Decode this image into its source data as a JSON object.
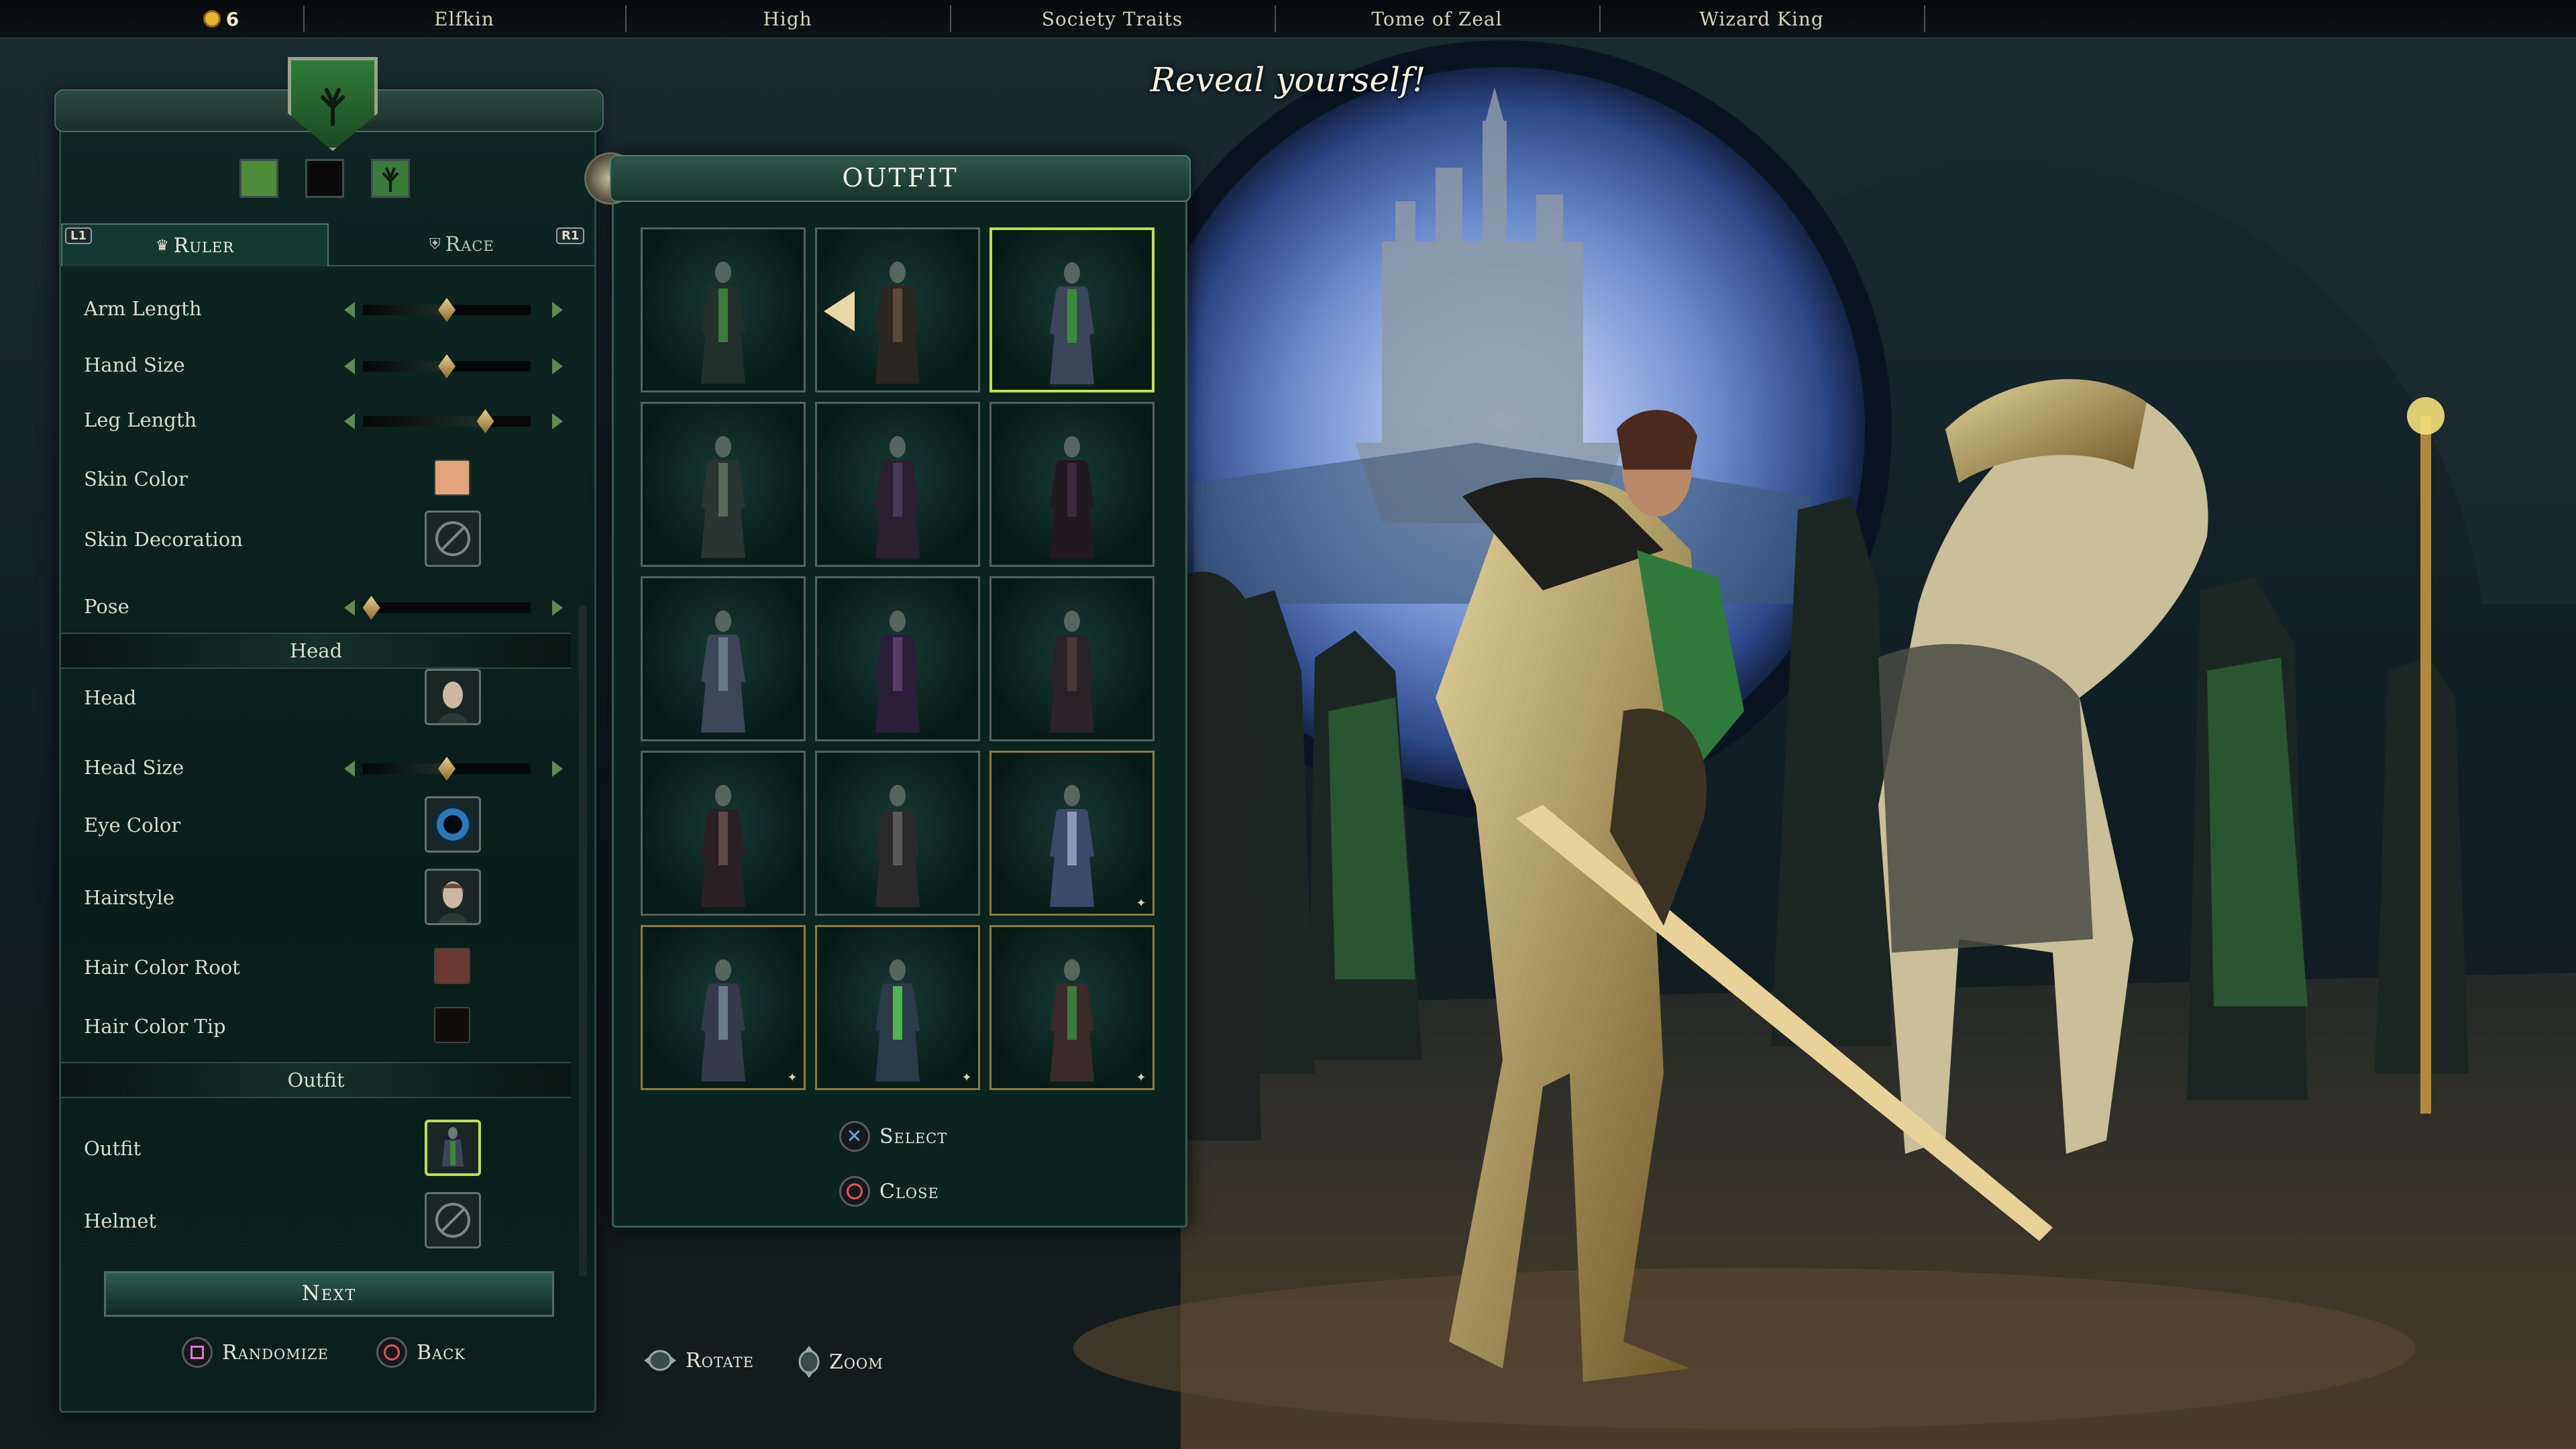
{
  "topbar": {
    "gold_count": "6",
    "items": [
      "Elfkin",
      "High",
      "Society Traits",
      "Tome of Zeal",
      "Wizard King"
    ]
  },
  "scene": {
    "title": "Reveal yourself!"
  },
  "left_panel": {
    "swatch_colors": [
      "#4f8c3a",
      "#0a0a0a",
      "#3a7a3a"
    ],
    "tabs": {
      "left_shoulder": "L1",
      "right_shoulder": "R1",
      "ruler": "Ruler",
      "race": "Race"
    },
    "rows_top": [
      {
        "label": "Arm Length",
        "type": "slider",
        "value": 0.5
      },
      {
        "label": "Hand Size",
        "type": "slider",
        "value": 0.5
      },
      {
        "label": "Leg Length",
        "type": "slider",
        "value": 0.73
      },
      {
        "label": "Skin Color",
        "type": "color",
        "color": "#e3a47c"
      },
      {
        "label": "Skin Decoration",
        "type": "picker",
        "icon": "none-icon"
      },
      {
        "label": "Pose",
        "type": "slider",
        "value": 0.05
      }
    ],
    "head_section": "Head",
    "rows_head": [
      {
        "label": "Head",
        "type": "picker",
        "icon": "head-portrait-icon"
      },
      {
        "label": "Head Size",
        "type": "slider",
        "value": 0.5
      },
      {
        "label": "Eye Color",
        "type": "picker",
        "icon": "eye-icon"
      },
      {
        "label": "Hairstyle",
        "type": "picker",
        "icon": "hairstyle-icon"
      },
      {
        "label": "Hair Color Root",
        "type": "color",
        "color": "#6a3a32"
      },
      {
        "label": "Hair Color Tip",
        "type": "color",
        "color": "#120e0c"
      }
    ],
    "outfit_section": "Outfit",
    "rows_outfit": [
      {
        "label": "Outfit",
        "type": "picker",
        "icon": "outfit-icon"
      },
      {
        "label": "Helmet",
        "type": "picker",
        "icon": "none-icon"
      }
    ],
    "next_label": "Next",
    "randomize_label": "Randomize",
    "back_label": "Back"
  },
  "outfit_panel": {
    "title": "OUTFIT",
    "select_label": "Select",
    "close_label": "Close",
    "grid": [
      {
        "robe": "#22302c",
        "accent": "#3b7a3a",
        "selected": false
      },
      {
        "robe": "#2a2620",
        "accent": "#5a4a3a",
        "selected": false
      },
      {
        "robe": "#3a4658",
        "accent": "#3a8a3a",
        "selected": true
      },
      {
        "robe": "#2a3430",
        "accent": "#5a6a5a",
        "selected": false
      },
      {
        "robe": "#2a2030",
        "accent": "#4a3a5a",
        "selected": false
      },
      {
        "robe": "#221820",
        "accent": "#3a2a3a",
        "selected": false
      },
      {
        "robe": "#3c4658",
        "accent": "#6a7a8a",
        "selected": false
      },
      {
        "robe": "#2a1e38",
        "accent": "#5a3a6a",
        "selected": false
      },
      {
        "robe": "#2a2226",
        "accent": "#4a3a3a",
        "selected": false
      },
      {
        "robe": "#2a2024",
        "accent": "#5a4a4a",
        "selected": false
      },
      {
        "robe": "#2a2a2a",
        "accent": "#5a5a5a",
        "selected": false
      },
      {
        "robe": "#3a4a6a",
        "accent": "#8a9aba",
        "selected": false
      },
      {
        "robe": "#343a4a",
        "accent": "#6a7a8a",
        "selected": false
      },
      {
        "robe": "#2a3a4a",
        "accent": "#4ab84a",
        "selected": false
      },
      {
        "robe": "#3a2a2a",
        "accent": "#3a7a3a",
        "selected": false
      }
    ]
  },
  "bottom_prompts": {
    "rotate_label": "Rotate",
    "zoom_label": "Zoom"
  },
  "colors": {
    "accent_green": "#bde04a",
    "panel_bg": "#0c2420",
    "gold": "#e6b52c"
  }
}
